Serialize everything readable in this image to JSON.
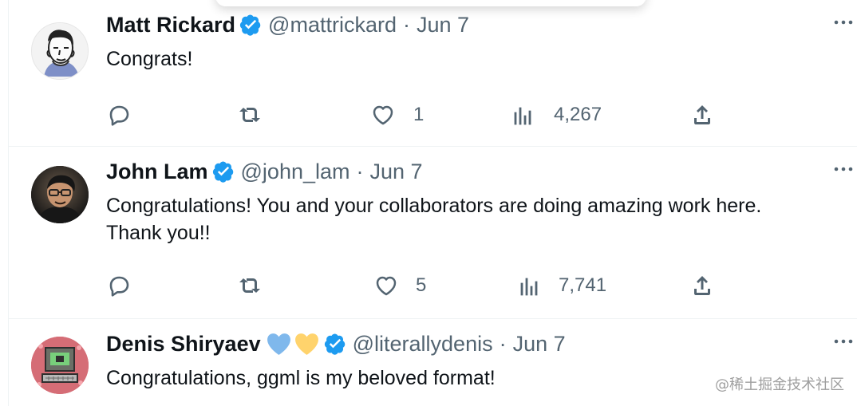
{
  "colors": {
    "text": "#0f1419",
    "muted": "#536471",
    "verified": "#1d9bf0",
    "blue_heart": "#7fb8ec",
    "yellow_heart": "#ffd36c",
    "border": "#eff3f4"
  },
  "tweets": [
    {
      "name": "Matt Rickard",
      "handle": "@mattrickard",
      "separator": "·",
      "time": "Jun 7",
      "text": "Congrats!",
      "more_icon": "more-horizontal-icon",
      "verified_icon": "verified-badge-icon",
      "avatar_icon": "portrait-sketch-avatar",
      "actions": {
        "reply_icon": "reply-icon",
        "retweet_icon": "retweet-icon",
        "like_icon": "heart-icon",
        "like_count": "1",
        "views_icon": "views-icon",
        "views_count": "4,267",
        "share_icon": "share-icon"
      }
    },
    {
      "name": "John Lam",
      "handle": "@john_lam",
      "separator": "·",
      "time": "Jun 7",
      "text": "Congratulations! You and your collaborators are doing amazing work here.\nThank you!!",
      "more_icon": "more-horizontal-icon",
      "verified_icon": "verified-badge-icon",
      "avatar_icon": "profile-photo-avatar",
      "actions": {
        "reply_icon": "reply-icon",
        "retweet_icon": "retweet-icon",
        "like_icon": "heart-icon",
        "like_count": "5",
        "views_icon": "views-icon",
        "views_count": "7,741",
        "share_icon": "share-icon"
      }
    },
    {
      "name": "Denis Shiryaev",
      "handle": "@literallydenis",
      "separator": "·",
      "time": "Jun 7",
      "text": "Congratulations, ggml is my beloved format!",
      "more_icon": "more-horizontal-icon",
      "verified_icon": "verified-badge-icon",
      "avatar_icon": "computer-avatar",
      "name_emojis": [
        "blue-heart-icon",
        "yellow-heart-icon"
      ]
    }
  ],
  "watermark": "@稀土掘金技术社区"
}
